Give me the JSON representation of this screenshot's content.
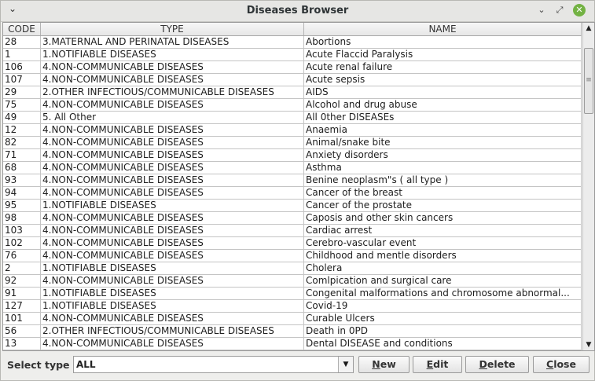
{
  "window": {
    "title": "Diseases Browser",
    "menu_icon": "chevron-down-icon",
    "minimize_icon": "minimize-icon",
    "restore_icon": "restore-icon",
    "close_icon": "close-icon"
  },
  "table": {
    "headers": [
      "CODE",
      "TYPE",
      "NAME"
    ],
    "rows": [
      [
        "28",
        "3.MATERNAL AND PERINATAL DISEASES",
        "Abortions"
      ],
      [
        "1",
        "1.NOTIFIABLE DISEASES",
        "Acute Flaccid Paralysis"
      ],
      [
        "106",
        "4.NON-COMMUNICABLE DISEASES",
        "Acute renal failure"
      ],
      [
        "107",
        "4.NON-COMMUNICABLE DISEASES",
        "Acute sepsis"
      ],
      [
        "29",
        "2.OTHER INFECTIOUS/COMMUNICABLE DISEASES",
        "AIDS"
      ],
      [
        "75",
        "4.NON-COMMUNICABLE DISEASES",
        "Alcohol and drug abuse"
      ],
      [
        "49",
        "5. All Other",
        "All 0ther DISEASEs"
      ],
      [
        "12",
        "4.NON-COMMUNICABLE DISEASES",
        "Anaemia"
      ],
      [
        "82",
        "4.NON-COMMUNICABLE DISEASES",
        "Animal/snake bite"
      ],
      [
        "71",
        "4.NON-COMMUNICABLE DISEASES",
        "Anxiety disorders"
      ],
      [
        "68",
        "4.NON-COMMUNICABLE DISEASES",
        "Asthma"
      ],
      [
        "93",
        "4.NON-COMMUNICABLE DISEASES",
        "Benine neoplasm\"s ( all type )"
      ],
      [
        "94",
        "4.NON-COMMUNICABLE DISEASES",
        "Cancer of the breast"
      ],
      [
        "95",
        "1.NOTIFIABLE DISEASES",
        "Cancer of the prostate"
      ],
      [
        "98",
        "4.NON-COMMUNICABLE DISEASES",
        "Caposis and other skin cancers"
      ],
      [
        "103",
        "4.NON-COMMUNICABLE DISEASES",
        "Cardiac arrest"
      ],
      [
        "102",
        "4.NON-COMMUNICABLE DISEASES",
        "Cerebro-vascular event"
      ],
      [
        "76",
        "4.NON-COMMUNICABLE DISEASES",
        "Childhood and mentle disorders"
      ],
      [
        "2",
        "1.NOTIFIABLE DISEASES",
        "Cholera"
      ],
      [
        "92",
        "4.NON-COMMUNICABLE DISEASES",
        "Comlpication and surgical care"
      ],
      [
        "91",
        "1.NOTIFIABLE DISEASES",
        "Congenital malformations and chromosome abnormal..."
      ],
      [
        "127",
        "1.NOTIFIABLE DISEASES",
        "Covid-19"
      ],
      [
        "101",
        "4.NON-COMMUNICABLE DISEASES",
        "Curable Ulcers"
      ],
      [
        "56",
        "2.OTHER INFECTIOUS/COMMUNICABLE DISEASES",
        "Death in 0PD"
      ],
      [
        "13",
        "4.NON-COMMUNICABLE DISEASES",
        "Dental DISEASE and conditions"
      ]
    ]
  },
  "footer": {
    "select_label": "Select type",
    "select_value": "ALL",
    "buttons": {
      "new_first": "N",
      "new_rest": "ew",
      "edit_first": "E",
      "edit_rest": "dit",
      "delete_first": "D",
      "delete_rest": "elete",
      "close_first": "C",
      "close_rest": "lose"
    }
  }
}
